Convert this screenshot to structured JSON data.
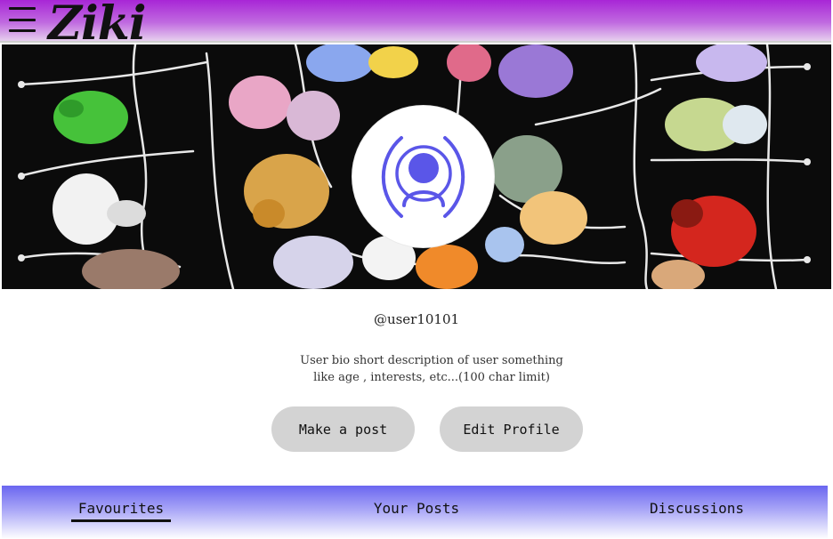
{
  "app": {
    "logo_text": "Ziki",
    "menu_icon": "hamburger-menu-icon"
  },
  "profile": {
    "username": "@user10101",
    "bio_line1": "User bio short description of user something",
    "bio_line2": "like age , interests, etc...(100 char limit)",
    "avatar_icon": "user-avatar-icon"
  },
  "actions": {
    "make_post_label": "Make a post",
    "edit_profile_label": "Edit Profile"
  },
  "tabs": [
    {
      "label": "Favourites",
      "active": true
    },
    {
      "label": "Your Posts",
      "active": false
    },
    {
      "label": "Discussions",
      "active": false
    }
  ],
  "colors": {
    "topbar_accent": "#a826d6",
    "tabbar_accent": "#6a66f0",
    "avatar_icon": "#5a56e8",
    "button_bg": "#d3d3d3"
  }
}
